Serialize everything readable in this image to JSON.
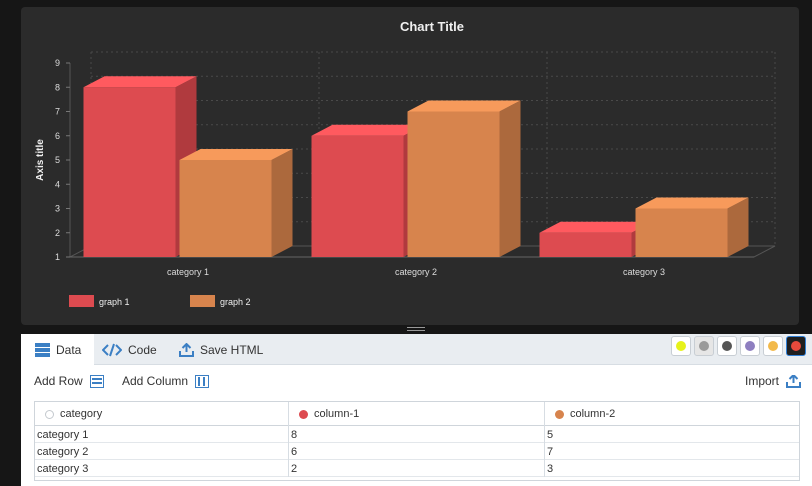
{
  "chart_data": {
    "type": "bar",
    "title": "Chart Title",
    "xlabel": "",
    "ylabel": "Axis title",
    "categories": [
      "category 1",
      "category 2",
      "category 3"
    ],
    "series": [
      {
        "name": "graph 1",
        "values": [
          8,
          6,
          2
        ],
        "color": "#dd4b50",
        "top_color": "#ff5a5f",
        "side_color": "#b03a3e"
      },
      {
        "name": "graph 2",
        "values": [
          5,
          7,
          3
        ],
        "color": "#d7844d",
        "top_color": "#f79a5b",
        "side_color": "#ac693d"
      }
    ],
    "ylim": [
      1,
      9
    ],
    "yticks": [
      1,
      2,
      3,
      4,
      5,
      6,
      7,
      8,
      9
    ],
    "grid": true,
    "legend_position": "bottom-left",
    "style": "3d-columns"
  },
  "editor": {
    "tabs": {
      "data": "Data",
      "code": "Code",
      "save": "Save HTML"
    },
    "themes": [
      {
        "name": "yellow-theme",
        "color": "#e6f21a"
      },
      {
        "name": "striped-theme",
        "color": "#9a9a9a"
      },
      {
        "name": "dark-theme",
        "color": "#555555"
      },
      {
        "name": "purple-theme",
        "color": "#8e7fc0"
      },
      {
        "name": "pastel-theme",
        "color": "#f2b94a"
      },
      {
        "name": "red-theme",
        "color": "#e64a3c"
      }
    ],
    "toolbar": {
      "add_row": "Add Row",
      "add_column": "Add Column",
      "import": "Import"
    },
    "grid": {
      "headers": [
        "category",
        "column-1",
        "column-2"
      ],
      "header_colors": [
        "#c4c9ce",
        "#dd4b50",
        "#d7844d"
      ],
      "rows": [
        [
          "category 1",
          "8",
          "5"
        ],
        [
          "category 2",
          "6",
          "7"
        ],
        [
          "category 3",
          "2",
          "3"
        ]
      ]
    }
  }
}
